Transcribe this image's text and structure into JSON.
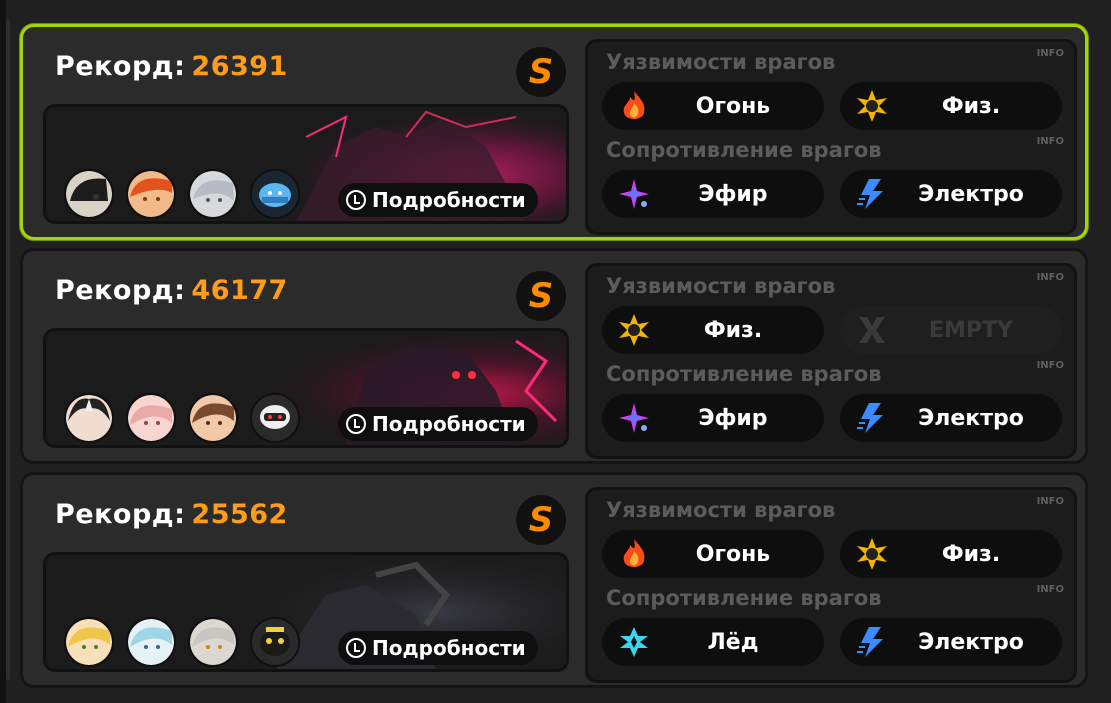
{
  "record_label": "Рекорд:",
  "details_label": "Подробности",
  "weak_title": "Уязвимости врагов",
  "res_title": "Сопротивление врагов",
  "info_label": "INFO",
  "rank_letter": "S",
  "colors": {
    "accent_selected": "#a6d40a",
    "record_value": "#ff9c1a",
    "rank": "#ff8a00"
  },
  "cards": [
    {
      "record": "26391",
      "selected": true,
      "weak": [
        {
          "icon": "fire-icon",
          "name": "Огонь"
        },
        {
          "icon": "physical-icon",
          "name": "Физ."
        }
      ],
      "res": [
        {
          "icon": "ether-icon",
          "name": "Эфир"
        },
        {
          "icon": "electric-icon",
          "name": "Электро"
        }
      ]
    },
    {
      "record": "46177",
      "selected": false,
      "weak": [
        {
          "icon": "physical-icon",
          "name": "Физ."
        },
        {
          "icon": "empty-x-icon",
          "name": "EMPTY"
        }
      ],
      "res": [
        {
          "icon": "ether-icon",
          "name": "Эфир"
        },
        {
          "icon": "electric-icon",
          "name": "Электро"
        }
      ]
    },
    {
      "record": "25562",
      "selected": false,
      "weak": [
        {
          "icon": "fire-icon",
          "name": "Огонь"
        },
        {
          "icon": "physical-icon",
          "name": "Физ."
        }
      ],
      "res": [
        {
          "icon": "ice-icon",
          "name": "Лёд"
        },
        {
          "icon": "electric-icon",
          "name": "Электро"
        }
      ]
    }
  ]
}
